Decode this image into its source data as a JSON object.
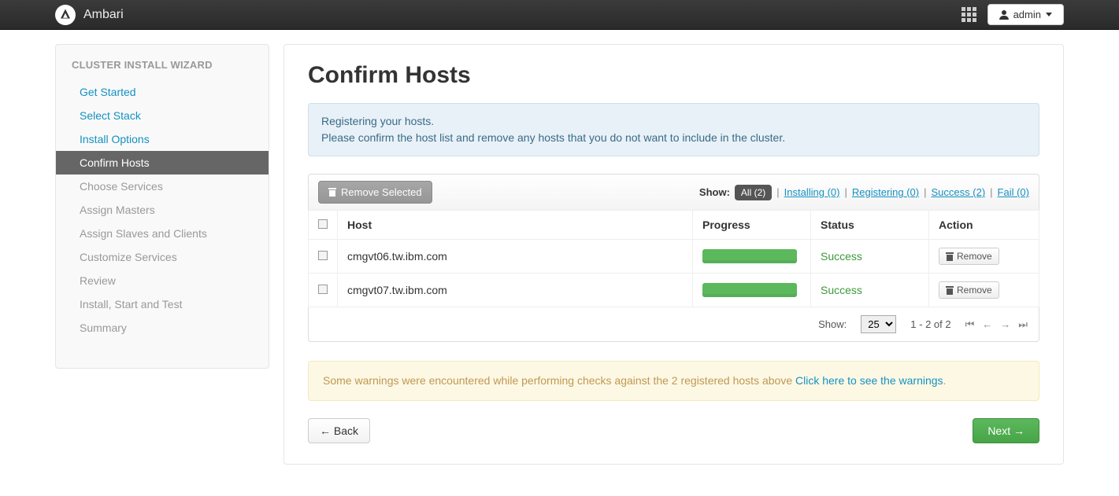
{
  "navbar": {
    "brand": "Ambari",
    "admin_label": "admin"
  },
  "sidebar": {
    "title": "CLUSTER INSTALL WIZARD",
    "steps": [
      {
        "label": "Get Started",
        "state": "done"
      },
      {
        "label": "Select Stack",
        "state": "done"
      },
      {
        "label": "Install Options",
        "state": "done"
      },
      {
        "label": "Confirm Hosts",
        "state": "current"
      },
      {
        "label": "Choose Services",
        "state": "future"
      },
      {
        "label": "Assign Masters",
        "state": "future"
      },
      {
        "label": "Assign Slaves and Clients",
        "state": "future"
      },
      {
        "label": "Customize Services",
        "state": "future"
      },
      {
        "label": "Review",
        "state": "future"
      },
      {
        "label": "Install, Start and Test",
        "state": "future"
      },
      {
        "label": "Summary",
        "state": "future"
      }
    ]
  },
  "page": {
    "title": "Confirm Hosts",
    "info_line1": "Registering your hosts.",
    "info_line2": "Please confirm the host list and remove any hosts that you do not want to include in the cluster.",
    "remove_selected": "Remove Selected",
    "show_label": "Show:",
    "filters": {
      "all": "All (2)",
      "installing": "Installing (0)",
      "registering": "Registering (0)",
      "success": "Success (2)",
      "fail": "Fail (0)"
    },
    "columns": {
      "host": "Host",
      "progress": "Progress",
      "status": "Status",
      "action": "Action"
    },
    "rows": [
      {
        "host": "cmgvt06.tw.ibm.com",
        "status": "Success",
        "remove": "Remove"
      },
      {
        "host": "cmgvt07.tw.ibm.com",
        "status": "Success",
        "remove": "Remove"
      }
    ],
    "pager": {
      "show": "Show:",
      "per_page": "25",
      "range": "1 - 2 of 2"
    },
    "warning_text": "Some warnings were encountered while performing checks against the 2 registered hosts above ",
    "warning_link": "Click here to see the warnings",
    "warning_period": ".",
    "back": "← Back",
    "next": "Next →"
  }
}
